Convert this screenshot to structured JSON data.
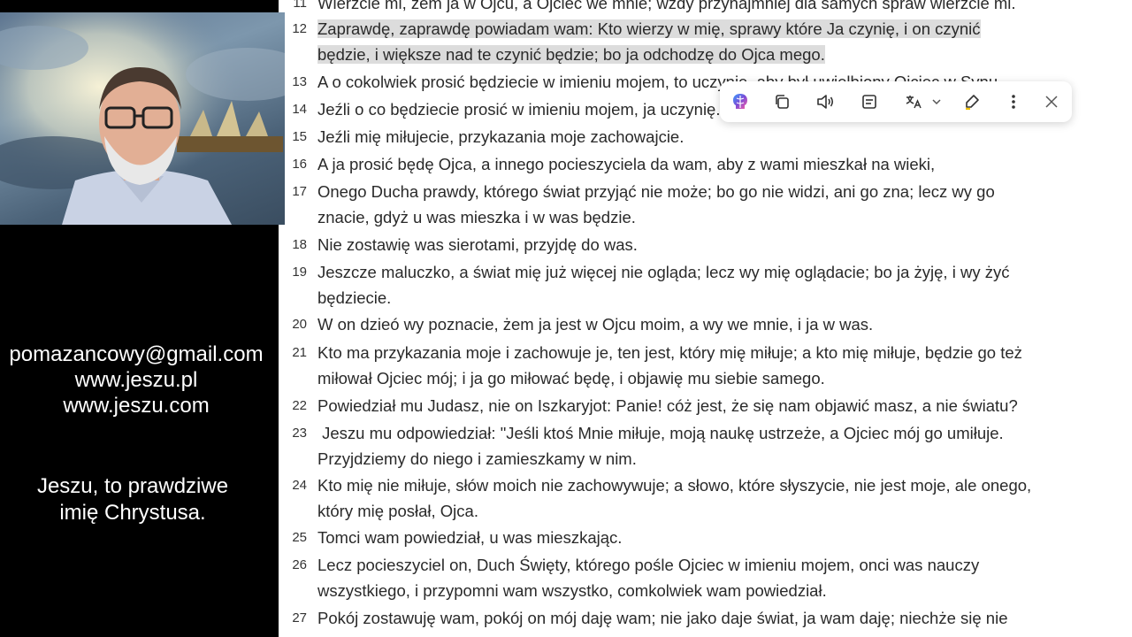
{
  "contact": {
    "email": "pomazancowy@gmail.com",
    "site1": "www.jeszu.pl",
    "site2": "www.jeszu.com"
  },
  "tagline": {
    "line1": "Jeszu, to prawdziwe",
    "line2": "imię Chrystusa."
  },
  "verses": [
    {
      "num": "11",
      "l1": "Wierzcie mi, żem ja w Ojcu, a Ojciec we mnie; wżdy przynajmniej dla samych spraw wierzcie mi."
    },
    {
      "num": "12",
      "l1": "Zaprawdę, zaprawdę powiadam wam: Kto wierzy w mię, sprawy które Ja czynię, i on czynić",
      "l2": "będzie, i większe nad te czynić będzie; bo ja odchodzę do Ojca mego."
    },
    {
      "num": "13",
      "l1": "A o cokolwiek prosić będziecie w imieniu mojem, to uczynię, aby był uwielbiony Ojciec w Synu."
    },
    {
      "num": "14",
      "l1": "Jeźli o co będziecie prosić w imieniu mojem, ja uczynię."
    },
    {
      "num": "15",
      "l1": "Jeźli mię miłujecie, przykazania moje zachowajcie."
    },
    {
      "num": "16",
      "l1": "A ja prosić będę Ojca, a innego pocieszyciela da wam, aby z wami mieszkał na wieki,"
    },
    {
      "num": "17",
      "l1": "Onego Ducha prawdy, którego świat przyjąć nie może; bo go nie widzi, ani go zna; lecz wy go",
      "l2": "znacie, gdyż u was mieszka i w was będzie."
    },
    {
      "num": "18",
      "l1": "Nie zostawię was sierotami, przyjdę do was."
    },
    {
      "num": "19",
      "l1": "Jeszcze maluczko, a świat mię już więcej nie ogląda; lecz wy mię oglądacie; bo ja żyję, i wy żyć",
      "l2": "będziecie."
    },
    {
      "num": "20",
      "l1": "W on dzieó wy poznacie, żem ja jest w Ojcu moim, a wy we mnie, i ja w was."
    },
    {
      "num": "21",
      "l1": "Kto ma przykazania moje i zachowuje je, ten jest, który mię miłuje; a kto mię miłuje, będzie go też",
      "l2": "miłował Ojciec mój; i ja go miłować będę, i objawię mu siebie samego."
    },
    {
      "num": "22",
      "l1": "Powiedział mu Judasz, nie on Iszkaryjot: Panie! cóż jest, że się nam objawić masz, a nie światu?"
    },
    {
      "num": "23",
      "l1": " Jeszu mu odpowiedział: \"Jeśli ktoś Mnie miłuje, moją naukę ustrzeże, a Ojciec mój go umiłuje.",
      "l2": "Przyjdziemy do niego i zamieszkamy w nim."
    },
    {
      "num": "24",
      "l1": "Kto mię nie miłuje, słów moich nie zachowywuje; a słowo, które słyszycie, nie jest moje, ale onego,",
      "l2": "który mię posłał, Ojca."
    },
    {
      "num": "25",
      "l1": "Tomci wam powiedział, u was mieszkając."
    },
    {
      "num": "26",
      "l1": "Lecz pocieszyciel on, Duch Święty, którego pośle Ojciec w imieniu mojem, onci was nauczy",
      "l2": "wszystkiego, i przypomni wam wszystko, comkolwiek wam powiedział."
    },
    {
      "num": "27",
      "l1": "Pokój zostawuję wam, pokój on mój daję wam; nie jako daje świat, ja wam daję; niechże się nie"
    }
  ],
  "toolbar": {
    "icons": [
      "copilot-icon",
      "copy-icon",
      "read-aloud-icon",
      "summarize-icon",
      "translate-icon",
      "chevron-down-icon",
      "highlight-icon",
      "more-icon",
      "close-icon"
    ],
    "accent": "#7b4bd6"
  }
}
